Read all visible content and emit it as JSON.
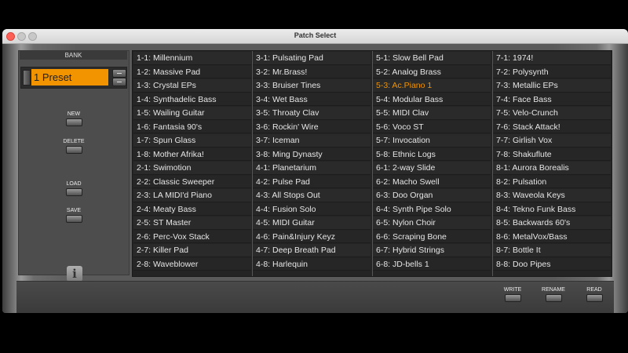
{
  "window": {
    "title": "Patch Select"
  },
  "left_panel": {
    "bank_header": "BANK",
    "preset_value": "1 Preset",
    "buttons": {
      "new": "NEW",
      "delete": "DELETE",
      "load": "LOAD",
      "save": "SAVE"
    }
  },
  "bottom": {
    "write": "WRITE",
    "rename": "RENAME",
    "read": "READ"
  },
  "selected_patch": "5-3: Ac.Piano 1",
  "accent_color": "#f29300",
  "icons": [
    "close-icon",
    "minimize-icon",
    "maximize-icon",
    "info-icon"
  ],
  "patches": [
    [
      "1-1: Millennium",
      "1-2: Massive Pad",
      "1-3: Crystal EPs",
      "1-4: Synthadelic Bass",
      "1-5: Wailing Guitar",
      "1-6: Fantasia 90's",
      "1-7: Spun Glass",
      "1-8: Mother Afrika!",
      "2-1: Swimotion",
      "2-2: Classic Sweeper",
      "2-3: LA MIDI'd Piano",
      "2-4: Meaty Bass",
      "2-5: ST Master",
      "2-6: Perc-Vox Stack",
      "2-7: Killer Pad",
      "2-8: Waveblower"
    ],
    [
      "3-1: Pulsating Pad",
      "3-2: Mr.Brass!",
      "3-3: Bruiser Tines",
      "3-4: Wet Bass",
      "3-5: Throaty Clav",
      "3-6: Rockin' Wire",
      "3-7: Iceman",
      "3-8: Ming Dynasty",
      "4-1: Planetarium",
      "4-2: Pulse Pad",
      "4-3: All Stops Out",
      "4-4: Fusion Solo",
      "4-5: MIDI Guitar",
      "4-6: Pain&Injury Keyz",
      "4-7: Deep Breath Pad",
      "4-8: Harlequin"
    ],
    [
      "5-1: Slow Bell Pad",
      "5-2: Analog Brass",
      "5-3: Ac.Piano 1",
      "5-4: Modular Bass",
      "5-5: MIDI Clav",
      "5-6: Voco ST",
      "5-7: Invocation",
      "5-8: Ethnic Logs",
      "6-1: 2-way Slide",
      "6-2: Macho Swell",
      "6-3: Doo Organ",
      "6-4: Synth Pipe Solo",
      "6-5: Nylon Choir",
      "6-6: Scraping Bone",
      "6-7: Hybrid Strings",
      "6-8: JD-bells 1"
    ],
    [
      "7-1: 1974!",
      "7-2: Polysynth",
      "7-3: Metallic EPs",
      "7-4: Face Bass",
      "7-5: Velo-Crunch",
      "7-6: Stack Attack!",
      "7-7: Girlish Vox",
      "7-8: Shakuflute",
      "8-1: Aurora Borealis",
      "8-2: Pulsation",
      "8-3: Waveola Keys",
      "8-4: Tekno Funk Bass",
      "8-5: Backwards 60's",
      "8-6: MetalVox/Bass",
      "8-7: Bottle It",
      "8-8: Doo Pipes"
    ]
  ]
}
